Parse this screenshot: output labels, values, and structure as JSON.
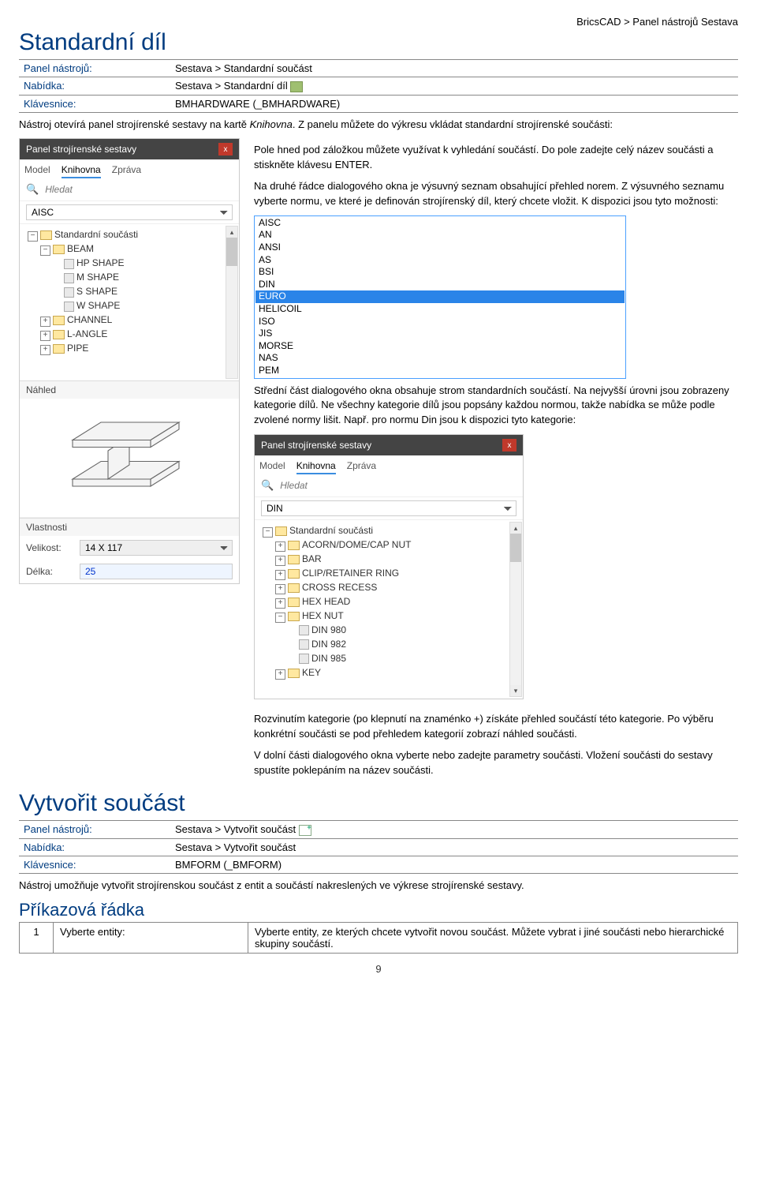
{
  "breadcrumb": "BricsCAD > Panel nástrojů Sestava",
  "h1_standard": "Standardní díl",
  "info1": {
    "toolbar_label": "Panel nástrojů:",
    "toolbar_value": "Sestava > Standardní součást",
    "menu_label": "Nabídka:",
    "menu_value": "Sestava > Standardní díl",
    "keyboard_label": "Klávesnice:",
    "keyboard_value": "BMHARDWARE (_BMHARDWARE)"
  },
  "intro": "Nástroj otevírá panel strojírenské sestavy na kartě Knihovna. Z panelu můžete do výkresu vkládat standardní strojírenské součásti:",
  "para1": "Pole hned pod záložkou můžete využívat k vyhledání součástí. Do pole zadejte celý název součásti a stiskněte klávesu ENTER.",
  "para2": "Na druhé řádce dialogového okna je výsuvný seznam obsahující přehled norem. Z výsuvného seznamu vyberte normu, ve které je definován strojírenský díl, který chcete vložit. K dispozici jsou tyto možnosti:",
  "para3": "Střední část dialogového okna obsahuje strom standardních součástí. Na nejvyšší úrovni jsou zobrazeny kategorie dílů. Ne všechny kategorie dílů jsou popsány každou normou, takže nabídka se může podle zvolené normy lišit. Např. pro normu Din jsou k dispozici tyto kategorie:",
  "para4": "Rozvinutím kategorie (po klepnutí na znaménko +) získáte přehled součástí této kategorie. Po výběru konkrétní součásti se pod přehledem kategorií zobrazí náhled součásti.",
  "para5": "V dolní části dialogového okna vyberte nebo zadejte parametry součásti. Vložení součásti do sestavy spustíte poklepáním na název součásti.",
  "panel1": {
    "title": "Panel strojírenské sestavy",
    "tabs": {
      "0": "Model",
      "1": "Knihovna",
      "2": "Zpráva"
    },
    "search_placeholder": "Hledat",
    "norm_selected": "AISC",
    "tree_root": "Standardní součásti",
    "tree_beam": "BEAM",
    "tree_items": {
      "0": "HP SHAPE",
      "1": "M SHAPE",
      "2": "S SHAPE",
      "3": "W SHAPE"
    },
    "tree_siblings": {
      "0": "CHANNEL",
      "1": "L-ANGLE",
      "2": "PIPE"
    },
    "sec_preview": "Náhled",
    "sec_props": "Vlastnosti",
    "prop_size_label": "Velikost:",
    "prop_size_value": "14 X 117",
    "prop_len_label": "Délka:",
    "prop_len_value": "25"
  },
  "norms": {
    "0": "AISC",
    "1": "AN",
    "2": "ANSI",
    "3": "AS",
    "4": "BSI",
    "5": "DIN",
    "6": "EURO",
    "7": "HELICOIL",
    "8": "ISO",
    "9": "JIS",
    "10": "MORSE",
    "11": "NAS",
    "12": "PEM"
  },
  "panel2": {
    "title": "Panel strojírenské sestavy",
    "tabs": {
      "0": "Model",
      "1": "Knihovna",
      "2": "Zpráva"
    },
    "search_placeholder": "Hledat",
    "norm_selected": "DIN",
    "tree_root": "Standardní součásti",
    "tree_items": {
      "0": "ACORN/DOME/CAP NUT",
      "1": "BAR",
      "2": "CLIP/RETAINER RING",
      "3": "CROSS RECESS",
      "4": "HEX HEAD",
      "5": "HEX NUT"
    },
    "tree_hexnut": {
      "0": "DIN 980",
      "1": "DIN 982",
      "2": "DIN 985"
    },
    "tree_last": "KEY"
  },
  "h1_create": "Vytvořit součást",
  "info2": {
    "toolbar_label": "Panel nástrojů:",
    "toolbar_value": "Sestava > Vytvořit součást",
    "menu_label": "Nabídka:",
    "menu_value": "Sestava > Vytvořit součást",
    "keyboard_label": "Klávesnice:",
    "keyboard_value": "BMFORM (_BMFORM)"
  },
  "create_desc": "Nástroj umožňuje vytvořit strojírenskou součást z entit a součástí nakreslených ve výkrese strojírenské sestavy.",
  "h2_cmdline": "Příkazová řádka",
  "cmd": {
    "num": "1",
    "label": "Vyberte entity:",
    "desc": "Vyberte entity, ze kterých chcete vytvořit novou součást. Můžete vybrat i jiné součásti nebo hierarchické skupiny součástí."
  },
  "page_no": "9"
}
